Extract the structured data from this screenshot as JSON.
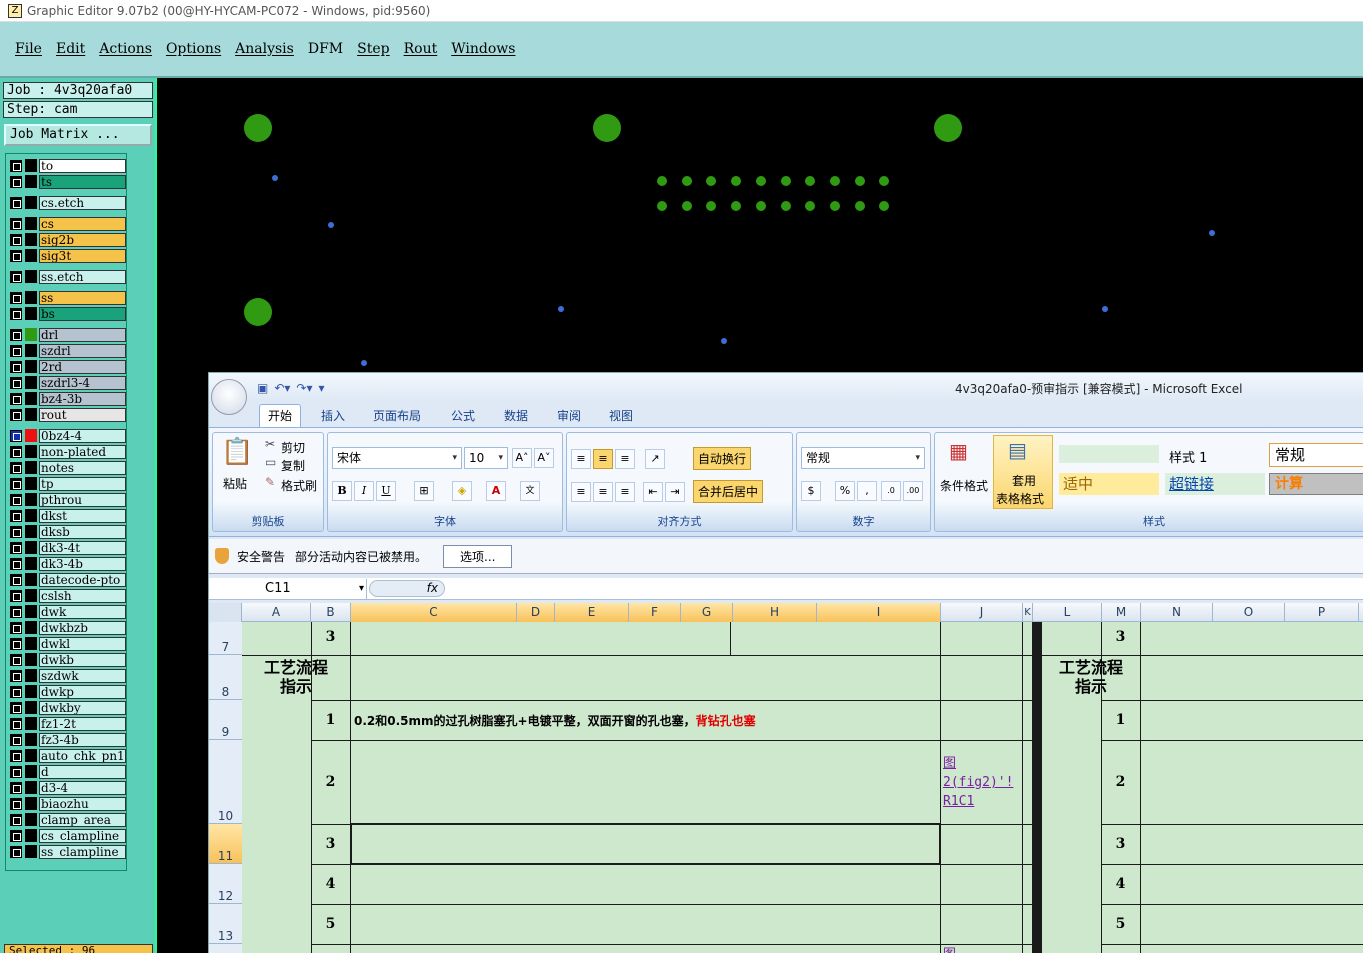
{
  "window_title": "Graphic Editor 9.07b2 (00@HY-HYCAM-PC072 - Windows, pid:9560)",
  "menu": [
    "File",
    "Edit",
    "Actions",
    "Options",
    "Analysis",
    "DFM",
    "Step",
    "Rout",
    "Windows"
  ],
  "job": {
    "job_label": "Job : 4v3q20afa0",
    "step_label": "Step: cam",
    "matrix_button": "Job Matrix ..."
  },
  "layers": [
    {
      "name": "to",
      "color": "#ffffff"
    },
    {
      "name": "ts",
      "color": "#1aa37a"
    },
    {
      "name": "cs.etch",
      "color": "#c8f0ec"
    },
    {
      "name": "cs",
      "color": "#f5c24a"
    },
    {
      "name": "sig2b",
      "color": "#f5c24a"
    },
    {
      "name": "sig3t",
      "color": "#f5c24a"
    },
    {
      "name": "ss.etch",
      "color": "#c8f0ec"
    },
    {
      "name": "ss",
      "color": "#f5c24a"
    },
    {
      "name": "bs",
      "color": "#1aa37a"
    },
    {
      "name": "drl",
      "color": "#b5c2cf"
    },
    {
      "name": "szdrl",
      "color": "#b5c2cf"
    },
    {
      "name": "2rd",
      "color": "#b5c2cf"
    },
    {
      "name": "szdrl3-4",
      "color": "#b5c2cf"
    },
    {
      "name": "bz4-3b",
      "color": "#b5c2cf"
    },
    {
      "name": "rout",
      "color": "#e6e6e6"
    },
    {
      "name": "0bz4-4",
      "color": "#c8f0ec"
    },
    {
      "name": "non-plated",
      "color": "#c8f0ec"
    },
    {
      "name": "notes",
      "color": "#c8f0ec"
    },
    {
      "name": "tp",
      "color": "#c8f0ec"
    },
    {
      "name": "pthrou",
      "color": "#c8f0ec"
    },
    {
      "name": "dkst",
      "color": "#c8f0ec"
    },
    {
      "name": "dksb",
      "color": "#c8f0ec"
    },
    {
      "name": "dk3-4t",
      "color": "#c8f0ec"
    },
    {
      "name": "dk3-4b",
      "color": "#c8f0ec"
    },
    {
      "name": "datecode-pto",
      "color": "#c8f0ec"
    },
    {
      "name": "cslsh",
      "color": "#c8f0ec"
    },
    {
      "name": "dwk",
      "color": "#c8f0ec"
    },
    {
      "name": "dwkbzb",
      "color": "#c8f0ec"
    },
    {
      "name": "dwkl",
      "color": "#c8f0ec"
    },
    {
      "name": "dwkb",
      "color": "#c8f0ec"
    },
    {
      "name": "szdwk",
      "color": "#c8f0ec"
    },
    {
      "name": "dwkp",
      "color": "#c8f0ec"
    },
    {
      "name": "dwkby",
      "color": "#c8f0ec"
    },
    {
      "name": "fz1-2t",
      "color": "#c8f0ec"
    },
    {
      "name": "fz3-4b",
      "color": "#c8f0ec"
    },
    {
      "name": "auto_chk_pn1",
      "color": "#c8f0ec"
    },
    {
      "name": "d",
      "color": "#c8f0ec"
    },
    {
      "name": "d3-4",
      "color": "#c8f0ec"
    },
    {
      "name": "biaozhu",
      "color": "#c8f0ec"
    },
    {
      "name": "clamp_area",
      "color": "#c8f0ec"
    },
    {
      "name": "cs_clampline",
      "color": "#c8f0ec"
    },
    {
      "name": "ss_clampline",
      "color": "#c8f0ec"
    }
  ],
  "selected_label": "Selected : 96",
  "excel": {
    "title": "4v3q20afa0-预审指示 [兼容模式] - Microsoft Excel",
    "tabs": [
      "开始",
      "插入",
      "页面布局",
      "公式",
      "数据",
      "审阅",
      "视图"
    ],
    "clipboard": {
      "paste": "粘贴",
      "cut": "剪切",
      "copy": "复制",
      "format_painter": "格式刷",
      "group": "剪贴板"
    },
    "font": {
      "name": "宋体",
      "size": "10",
      "group": "字体"
    },
    "alignment": {
      "wrap": "自动换行",
      "merge": "合并后居中",
      "group": "对齐方式"
    },
    "number": {
      "format": "常规",
      "group": "数字"
    },
    "styles": {
      "cond": "条件格式",
      "table_l1": "套用",
      "table_l2": "表格格式",
      "style1": "样式 1",
      "normal": "常规",
      "medium": "适中",
      "hyperlink": "超链接",
      "calc": "计算",
      "group": "样式"
    },
    "security": {
      "title": "安全警告",
      "message": "部分活动内容已被禁用。",
      "button": "选项..."
    },
    "name_box": "C11",
    "fx": "fx",
    "columns": [
      "A",
      "B",
      "C",
      "D",
      "E",
      "F",
      "G",
      "H",
      "I",
      "J",
      "K",
      "L",
      "M",
      "N",
      "O",
      "P"
    ],
    "rows": [
      "7",
      "8",
      "9",
      "10",
      "11",
      "12",
      "13"
    ],
    "row7_b": "3",
    "row7_m": "3",
    "process_left": "工艺流程\n指示",
    "process_right": "工艺流程\n指示",
    "row9_b": "1",
    "row9_text": "0.2和0.5mm的过孔树脂塞孔+电镀平整，双面开窗的孔也塞，",
    "row9_red": "背钻孔也塞",
    "row10_b": "2",
    "row10_link": "图\n2(fig2)'!\nR1C1",
    "row11_b": "3",
    "row12_b": "4",
    "row13_b": "5",
    "right_nums": [
      "1",
      "2",
      "3",
      "4",
      "5"
    ],
    "bottom_link": "图"
  },
  "colors": {
    "pad": "#2f9a12",
    "dot": "#3b6fd6",
    "panel": "#5ccfb8",
    "menubar": "#a7dbdb"
  }
}
